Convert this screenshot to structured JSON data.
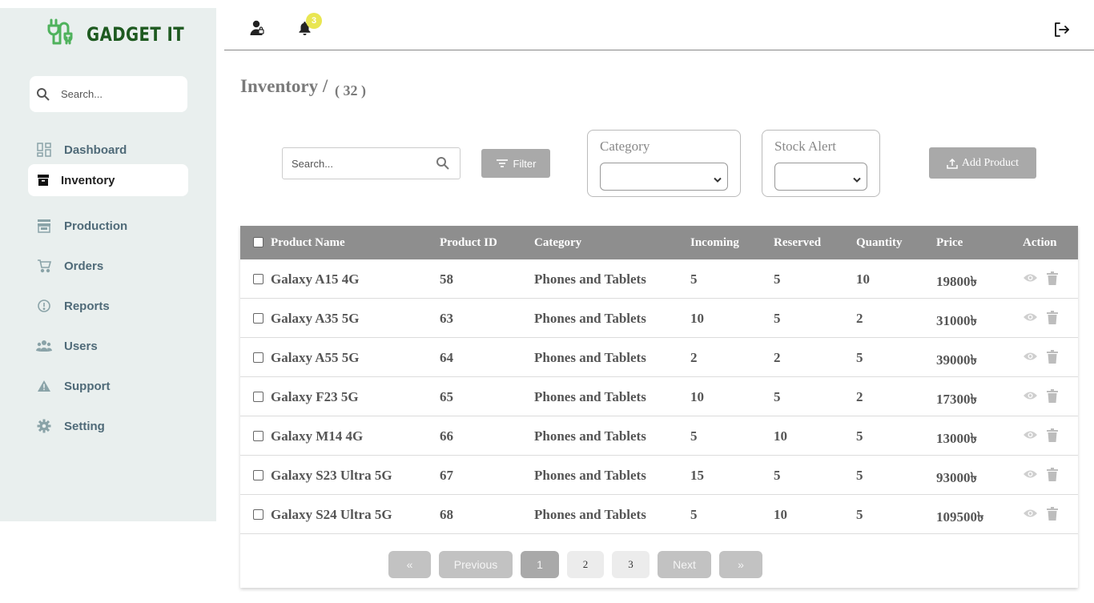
{
  "app": {
    "brand": "GADGET IT"
  },
  "sidebar": {
    "search_placeholder": "Search...",
    "items": [
      {
        "label": "Dashboard",
        "icon": "grid-icon",
        "active": false
      },
      {
        "label": "Inventory",
        "icon": "archive-icon",
        "active": true
      },
      {
        "label": "Production",
        "icon": "store-icon",
        "active": false
      },
      {
        "label": "Orders",
        "icon": "cart-icon",
        "active": false
      },
      {
        "label": "Reports",
        "icon": "alert-circle-icon",
        "active": false
      },
      {
        "label": "Users",
        "icon": "users-icon",
        "active": false
      },
      {
        "label": "Support",
        "icon": "warning-icon",
        "active": false
      },
      {
        "label": "Setting",
        "icon": "gear-icon",
        "active": false
      }
    ]
  },
  "topbar": {
    "notification_count": "3"
  },
  "page": {
    "title": "Inventory /",
    "count": "( 32 )"
  },
  "toolbar": {
    "search_placeholder": "Search...",
    "filter_label": "Filter",
    "category_label": "Category",
    "stock_alert_label": "Stock Alert",
    "add_product_label": "Add Product"
  },
  "table": {
    "headers": [
      "Product Name",
      "Product ID",
      "Category",
      "Incoming",
      "Reserved",
      "Quantity",
      "Price",
      "Action"
    ],
    "rows": [
      {
        "name": "Galaxy A15 4G",
        "id": "58",
        "category": "Phones and Tablets",
        "incoming": "5",
        "reserved": "5",
        "quantity": "10",
        "price": "19800৳"
      },
      {
        "name": "Galaxy A35 5G",
        "id": "63",
        "category": "Phones and Tablets",
        "incoming": "10",
        "reserved": "5",
        "quantity": "2",
        "price": "31000৳"
      },
      {
        "name": "Galaxy A55 5G",
        "id": "64",
        "category": "Phones and Tablets",
        "incoming": "2",
        "reserved": "2",
        "quantity": "5",
        "price": "39000৳"
      },
      {
        "name": "Galaxy F23 5G",
        "id": "65",
        "category": "Phones and Tablets",
        "incoming": "10",
        "reserved": "5",
        "quantity": "2",
        "price": "17300৳"
      },
      {
        "name": "Galaxy M14 4G",
        "id": "66",
        "category": "Phones and Tablets",
        "incoming": "5",
        "reserved": "10",
        "quantity": "5",
        "price": "13000৳"
      },
      {
        "name": "Galaxy S23 Ultra 5G",
        "id": "67",
        "category": "Phones and Tablets",
        "incoming": "15",
        "reserved": "5",
        "quantity": "5",
        "price": "93000৳"
      },
      {
        "name": "Galaxy S24 Ultra 5G",
        "id": "68",
        "category": "Phones and Tablets",
        "incoming": "5",
        "reserved": "10",
        "quantity": "5",
        "price": "109500৳"
      }
    ]
  },
  "pagination": {
    "first": "«",
    "previous": "Previous",
    "pages": [
      "1",
      "2",
      "3"
    ],
    "current": "1",
    "next": "Next",
    "last": "»"
  },
  "colors": {
    "sidebar_bg": "#e9efee",
    "brand_green": "#1e5a20",
    "logo_green": "#4fb25c",
    "table_header": "#8e8e8e",
    "button_gray": "#a9a9a9",
    "badge_yellow": "#e9e652"
  }
}
